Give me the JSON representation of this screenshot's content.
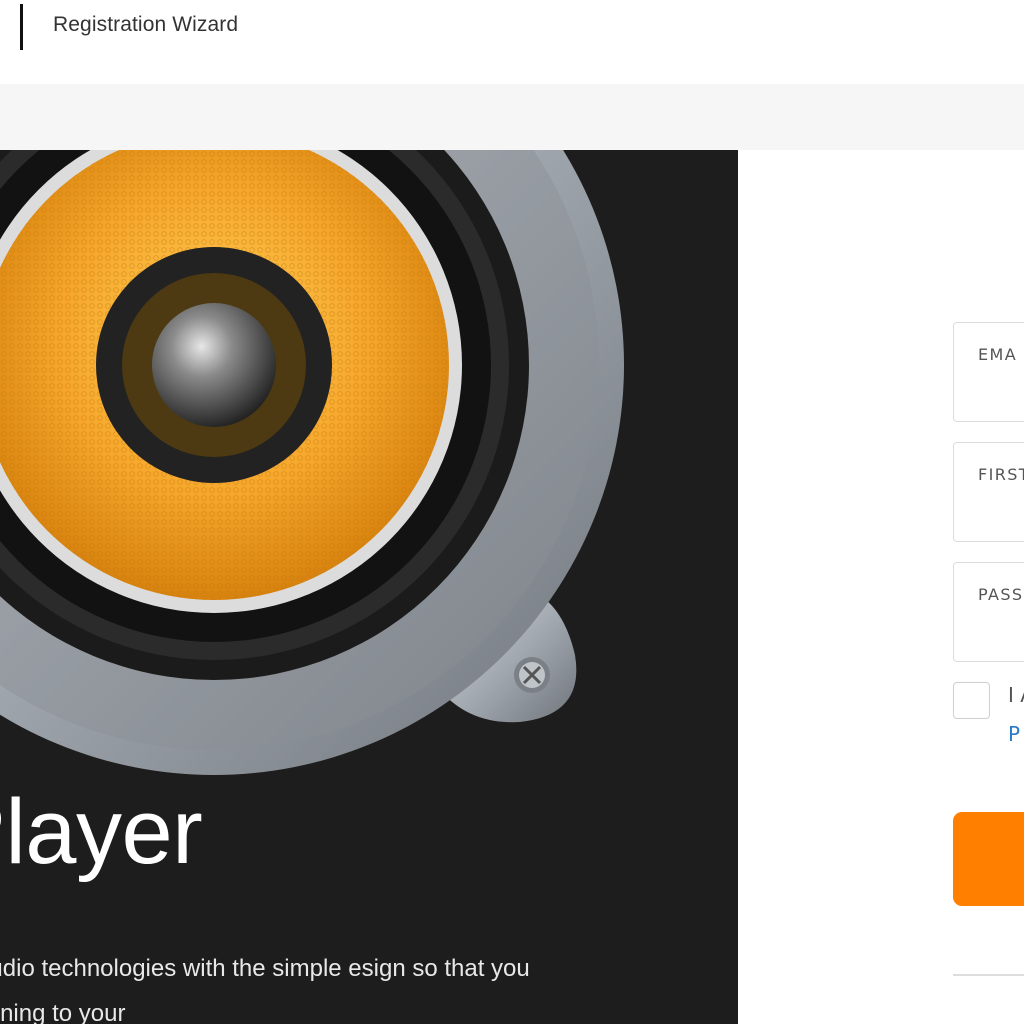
{
  "header": {
    "title": "Registration Wizard"
  },
  "hero": {
    "image_icon": "speaker-icon",
    "title": "ic Player",
    "description": "he newest audio technologies with the simple esign so that you focus on listening to your"
  },
  "form": {
    "email_label": "EMA",
    "first_name_label": "FIRST",
    "password_label": "PASS",
    "agree_text": "I A",
    "policy_link": "P",
    "submit_label": "",
    "accent_color": "#ff7f00"
  }
}
